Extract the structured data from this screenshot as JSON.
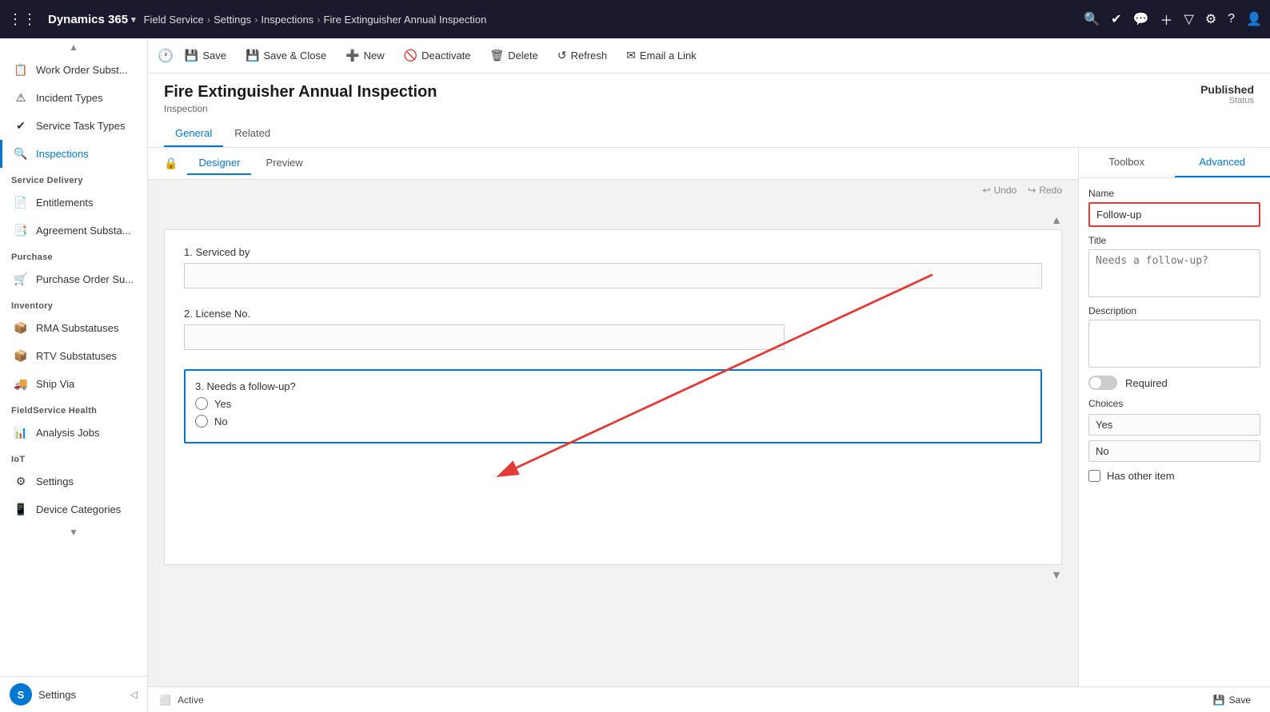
{
  "topNav": {
    "waffleIcon": "⋮⋮",
    "appName": "Dynamics 365",
    "module": "Field Service",
    "breadcrumbs": [
      {
        "label": "Settings"
      },
      {
        "label": "Inspections"
      },
      {
        "label": "Fire Extinguisher Annual Inspection"
      }
    ],
    "navIcons": [
      "🔍",
      "✓",
      "💬",
      "+",
      "▽",
      "⚙",
      "?",
      "👤"
    ]
  },
  "sidebar": {
    "toggleIcon": "☰",
    "items": [
      {
        "id": "work-order-subst",
        "icon": "📋",
        "label": "Work Order Subst..."
      },
      {
        "id": "incident-types",
        "icon": "⚠",
        "label": "Incident Types"
      },
      {
        "id": "service-task-types",
        "icon": "✔",
        "label": "Service Task Types"
      },
      {
        "id": "inspections",
        "icon": "🔍",
        "label": "Inspections",
        "active": true
      }
    ],
    "sections": [
      {
        "label": "Service Delivery",
        "items": [
          {
            "id": "entitlements",
            "icon": "📄",
            "label": "Entitlements"
          },
          {
            "id": "agreement-substa",
            "icon": "📑",
            "label": "Agreement Substa..."
          }
        ]
      },
      {
        "label": "Purchase",
        "items": [
          {
            "id": "purchase-order-su",
            "icon": "🛒",
            "label": "Purchase Order Su..."
          }
        ]
      },
      {
        "label": "Inventory",
        "items": [
          {
            "id": "rma-substatuses",
            "icon": "📦",
            "label": "RMA Substatuses"
          },
          {
            "id": "rtv-substatuses",
            "icon": "📦",
            "label": "RTV Substatuses"
          },
          {
            "id": "ship-via",
            "icon": "🚚",
            "label": "Ship Via"
          }
        ]
      },
      {
        "label": "FieldService Health",
        "items": [
          {
            "id": "analysis-jobs",
            "icon": "📊",
            "label": "Analysis Jobs"
          }
        ]
      },
      {
        "label": "IoT",
        "items": [
          {
            "id": "settings-iot",
            "icon": "⚙",
            "label": "Settings"
          },
          {
            "id": "device-categories",
            "icon": "📱",
            "label": "Device Categories"
          }
        ]
      }
    ],
    "userSection": {
      "userInitial": "S",
      "userName": "Settings"
    }
  },
  "commandBar": {
    "buttons": [
      {
        "id": "save",
        "icon": "💾",
        "label": "Save"
      },
      {
        "id": "save-close",
        "icon": "💾",
        "label": "Save & Close"
      },
      {
        "id": "new",
        "icon": "+",
        "label": "New"
      },
      {
        "id": "deactivate",
        "icon": "🚫",
        "label": "Deactivate"
      },
      {
        "id": "delete",
        "icon": "🗑",
        "label": "Delete"
      },
      {
        "id": "refresh",
        "icon": "↺",
        "label": "Refresh"
      },
      {
        "id": "email-link",
        "icon": "✉",
        "label": "Email a Link"
      }
    ]
  },
  "record": {
    "title": "Fire Extinguisher Annual Inspection",
    "subtitle": "Inspection",
    "status": "Published",
    "statusLabel": "Status",
    "tabs": [
      {
        "id": "general",
        "label": "General",
        "active": true
      },
      {
        "id": "related",
        "label": "Related"
      }
    ]
  },
  "designerTabs": [
    {
      "id": "designer",
      "label": "Designer",
      "active": true
    },
    {
      "id": "preview",
      "label": "Preview"
    }
  ],
  "undoRedo": {
    "undoLabel": "Undo",
    "redoLabel": "Redo"
  },
  "formQuestions": [
    {
      "number": "1",
      "label": "Serviced by",
      "type": "text",
      "placeholder": ""
    },
    {
      "number": "2",
      "label": "License No.",
      "type": "text",
      "placeholder": ""
    },
    {
      "number": "3",
      "label": "Needs a follow-up?",
      "type": "radio",
      "options": [
        "Yes",
        "No"
      ],
      "selected": true
    }
  ],
  "rightPanel": {
    "tabs": [
      {
        "id": "toolbox",
        "label": "Toolbox"
      },
      {
        "id": "advanced",
        "label": "Advanced",
        "active": true
      }
    ],
    "fields": {
      "nameLabel": "Name",
      "nameValue": "Follow-up",
      "nameHighlighted": true,
      "titleLabel": "Title",
      "titlePlaceholder": "Needs a follow-up?",
      "descriptionLabel": "Description",
      "descriptionValue": "",
      "requiredLabel": "Required",
      "requiredOn": false,
      "choicesLabel": "Choices",
      "choices": [
        "Yes",
        "No"
      ],
      "hasOtherLabel": "Has other item",
      "hasOtherChecked": false
    }
  },
  "statusBar": {
    "statusIcon": "⬜",
    "statusText": "Active",
    "saveLabel": "Save"
  }
}
